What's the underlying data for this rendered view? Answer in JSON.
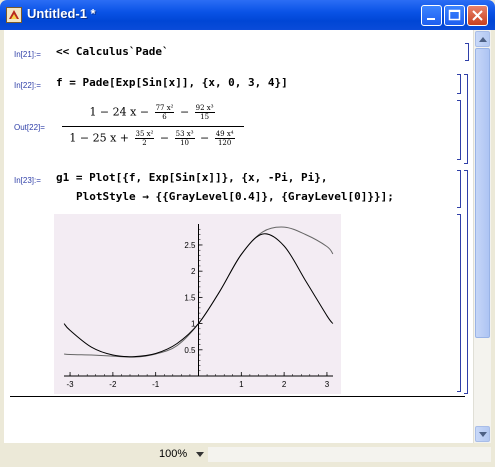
{
  "window": {
    "title": "Untitled-1 *"
  },
  "cells": {
    "in21": {
      "label": "In[21]:=",
      "code": "<< Calculus`Pade`"
    },
    "in22": {
      "label": "In[22]:=",
      "code": "f = Pade[Exp[Sin[x]], {x, 0, 3, 4}]"
    },
    "out22": {
      "label": "Out[22]=",
      "num_prefix": "1 − 24 x −",
      "num_t2_n": "77 x²",
      "num_t2_d": "6",
      "num_t3_sep": "−",
      "num_t3_n": "92 x³",
      "num_t3_d": "15",
      "den_prefix": "1 − 25 x +",
      "den_t2_n": "35 x²",
      "den_t2_d": "2",
      "den_t3_sep": "−",
      "den_t3_n": "53 x³",
      "den_t3_d": "10",
      "den_t4_sep": "−",
      "den_t4_n": "49 x⁴",
      "den_t4_d": "120"
    },
    "in23": {
      "label": "In[23]:=",
      "line1": "g1 = Plot[{f, Exp[Sin[x]]}, {x, -Pi, Pi},",
      "line2": "PlotStyle → {{GrayLevel[0.4]}, {GrayLevel[0]}}];"
    }
  },
  "statusbar": {
    "zoom": "100%"
  },
  "icons": [
    "app-icon",
    "minimize-icon",
    "maximize-icon",
    "close-icon",
    "scroll-up-icon",
    "scroll-down-icon",
    "zoom-dropdown-icon"
  ],
  "chart_data": {
    "type": "line",
    "title": "",
    "xlabel": "",
    "ylabel": "",
    "xlim": [
      -3.14159,
      3.14159
    ],
    "ylim": [
      0,
      2.9
    ],
    "x_ticks": [
      "-3",
      "-2",
      "-1",
      "1",
      "2",
      "3"
    ],
    "y_ticks": [
      "0.5",
      "1",
      "1.5",
      "2",
      "2.5"
    ],
    "background": "#f3ecf3",
    "series": [
      {
        "color": "#666666",
        "x": [
          -3.14,
          -3.0,
          -2.5,
          -2.0,
          -1.5,
          -1.0,
          -0.5,
          0.0,
          0.5,
          1.0,
          1.5,
          2.0,
          2.5,
          3.0,
          3.14
        ],
        "y": [
          0.42,
          0.41,
          0.4,
          0.38,
          0.36,
          0.42,
          0.58,
          1.0,
          1.62,
          2.32,
          2.75,
          2.84,
          2.7,
          2.47,
          2.33
        ]
      },
      {
        "color": "#000000",
        "x": [
          -3.14,
          -3.0,
          -2.5,
          -2.0,
          -1.5,
          -1.0,
          -0.5,
          0.0,
          0.5,
          1.0,
          1.5,
          2.0,
          2.5,
          3.0,
          3.14
        ],
        "y": [
          1.0,
          0.87,
          0.55,
          0.4,
          0.37,
          0.43,
          0.62,
          1.0,
          1.62,
          2.32,
          2.71,
          2.48,
          1.82,
          1.15,
          1.0
        ]
      }
    ]
  }
}
